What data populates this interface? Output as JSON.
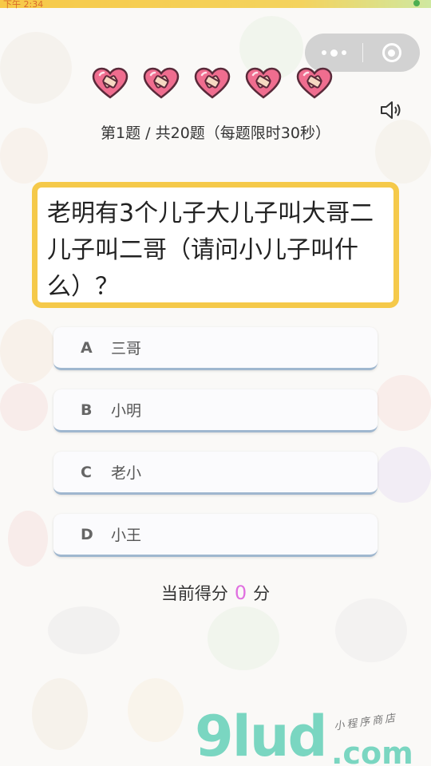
{
  "status_bar": {
    "text": "下午 2:34"
  },
  "capsule": {
    "more_icon": "more-dots-icon",
    "close_icon": "close-circle-icon"
  },
  "lives": {
    "count": 5,
    "icon": "bandaged-heart-icon",
    "color": "#ef6d8f"
  },
  "sound_icon": "speaker-icon",
  "progress_text": "第1题 / 共20题（每题限时30秒）",
  "question": "老明有3个儿子大儿子叫大哥二儿子叫二哥（请问小儿子叫什么）？",
  "options": [
    {
      "letter": "A",
      "text": "三哥"
    },
    {
      "letter": "B",
      "text": "小明"
    },
    {
      "letter": "C",
      "text": "老小"
    },
    {
      "letter": "D",
      "text": "小王"
    }
  ],
  "score": {
    "prefix": "当前得分",
    "value": "0",
    "suffix": "分"
  },
  "watermark": {
    "logo": "9lud",
    "domain": ".com",
    "note": "小程序商店"
  },
  "colors": {
    "accent_border": "#f5c94a",
    "score_value": "#e070e0",
    "option_underline": "#9fb7cf"
  }
}
